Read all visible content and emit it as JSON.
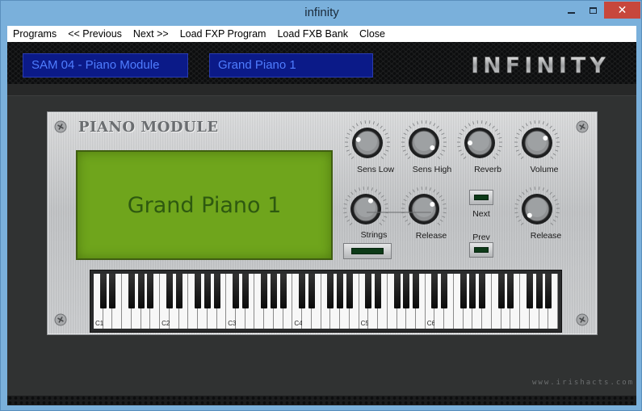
{
  "window": {
    "title": "infinity",
    "close_glyph": "✕"
  },
  "menu": {
    "items": [
      "Programs",
      "<< Previous",
      "Next >>",
      "Load FXP Program",
      "Load FXB Bank",
      "Close"
    ]
  },
  "header": {
    "program_name": "SAM 04 - Piano Module",
    "preset_name": "Grand Piano 1",
    "logo_text": "INFINITY"
  },
  "module": {
    "title": "PIANO MODULE",
    "display_text": "Grand Piano 1",
    "knobs": [
      {
        "label": "Sens Low"
      },
      {
        "label": "Sens High"
      },
      {
        "label": "Reverb"
      },
      {
        "label": "Volume"
      },
      {
        "label": "Strings"
      },
      {
        "label": "Release"
      },
      {
        "label": "Release"
      }
    ],
    "buttons": {
      "next_label": "Next",
      "prev_label": "Prev"
    },
    "octave_labels": [
      "C1",
      "C2",
      "C3",
      "C4",
      "C5",
      "C6"
    ]
  },
  "watermark": "www.irishacts.com",
  "colors": {
    "lcd_blue_bg": "#0b1a88",
    "lcd_blue_text": "#4f7dff",
    "green_display": "#6fa51c",
    "close_red": "#c7473c"
  }
}
